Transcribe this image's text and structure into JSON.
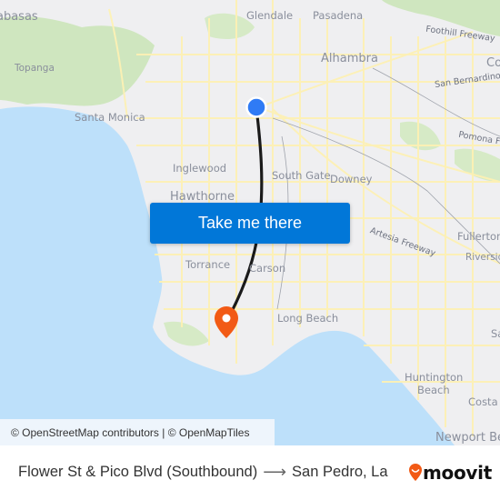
{
  "map": {
    "places": [
      {
        "name": "labasas",
        "label": "abasas"
      },
      {
        "name": "glendale",
        "label": "Glendale"
      },
      {
        "name": "pasadena",
        "label": "Pasadena"
      },
      {
        "name": "alhambra",
        "label": "Alhambra"
      },
      {
        "name": "topanga",
        "label": "Topanga"
      },
      {
        "name": "santa-monica",
        "label": "Santa Monica"
      },
      {
        "name": "inglewood",
        "label": "Inglewood"
      },
      {
        "name": "hawthorne",
        "label": "Hawthorne"
      },
      {
        "name": "south-gate",
        "label": "South Gate"
      },
      {
        "name": "downey",
        "label": "Downey"
      },
      {
        "name": "torrance",
        "label": "Torrance"
      },
      {
        "name": "carson",
        "label": "Carson"
      },
      {
        "name": "long-beach",
        "label": "Long Beach"
      },
      {
        "name": "fullerton",
        "label": "Fullerton"
      },
      {
        "name": "riverside",
        "label": "Riverside"
      },
      {
        "name": "huntington-beach-1",
        "label": "Huntington"
      },
      {
        "name": "huntington-beach-2",
        "label": "Beach"
      },
      {
        "name": "costa-mesa",
        "label": "Costa M"
      },
      {
        "name": "newport-beach",
        "label": "Newport Be"
      },
      {
        "name": "covina",
        "label": "Co"
      },
      {
        "name": "santa-ana",
        "label": "Sa"
      }
    ],
    "roads": [
      {
        "name": "foothill-freeway",
        "label": "Foothill Freeway"
      },
      {
        "name": "san-bernardino",
        "label": "San Bernardino"
      },
      {
        "name": "pomona-freeway",
        "label": "Pomona Fr"
      },
      {
        "name": "artesia-freeway",
        "label": "Artesia Freeway"
      }
    ],
    "colors": {
      "water": "#bde0fa",
      "land": "#efeff1",
      "park": "#cfe6bf",
      "road": "#fdf1b4",
      "route": "#1a1a1a",
      "origin": "#2f7bf5",
      "destination": "#f25a15"
    },
    "attribution": "© OpenStreetMap contributors | © OpenMapTiles"
  },
  "cta": {
    "label": "Take me there"
  },
  "footer": {
    "origin": "Flower St & Pico Blvd (Southbound)",
    "arrow": "⟶",
    "destination": "San Pedro, La",
    "brand": "moovit"
  }
}
